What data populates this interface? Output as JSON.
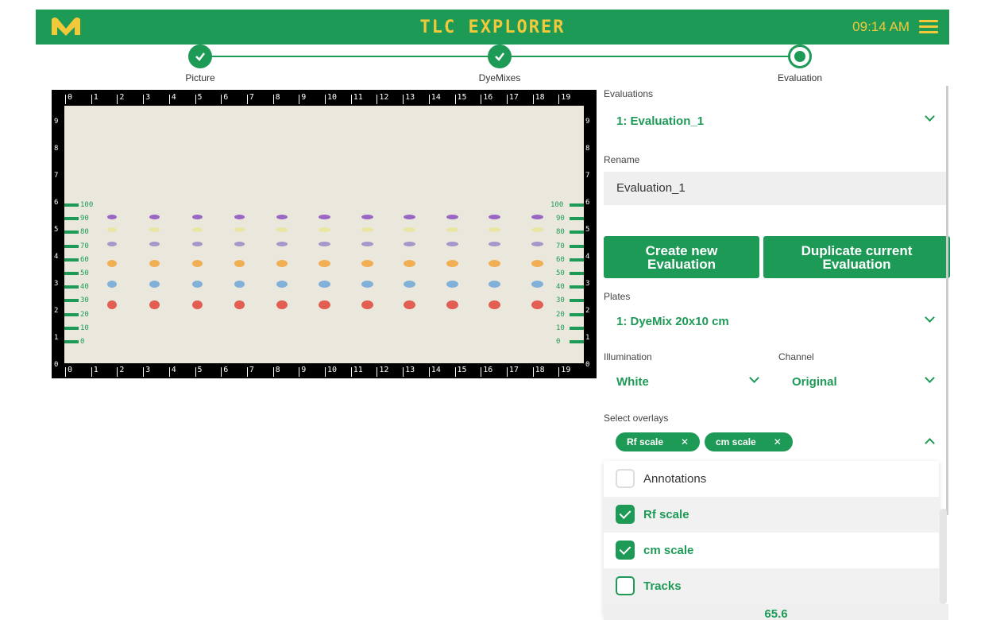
{
  "header": {
    "title": "TLC EXPLORER",
    "time": "09:14 AM",
    "brand_color": "#1e9a57",
    "accent_color": "#f3c93a"
  },
  "stepper": {
    "steps": [
      {
        "label": "Picture",
        "state": "done"
      },
      {
        "label": "DyeMixes",
        "state": "done"
      },
      {
        "label": "Evaluation",
        "state": "active"
      }
    ]
  },
  "plate": {
    "cm_ticks": [
      "0",
      "1",
      "2",
      "3",
      "4",
      "5",
      "6",
      "7",
      "8",
      "9",
      "10",
      "11",
      "12",
      "13",
      "14",
      "15",
      "16",
      "17",
      "18",
      "19"
    ],
    "side_ticks": [
      "9",
      "8",
      "7",
      "6",
      "5",
      "4",
      "3",
      "2",
      "1",
      "0"
    ],
    "rf_ticks": [
      "100",
      "90",
      "80",
      "70",
      "60",
      "50",
      "40",
      "30",
      "20",
      "10",
      "0"
    ],
    "tracks": 11
  },
  "panel": {
    "evaluations": {
      "label": "Evaluations",
      "value": "1: Evaluation_1"
    },
    "rename": {
      "label": "Rename",
      "value": "Evaluation_1"
    },
    "buttons": {
      "create": "Create new Evaluation",
      "duplicate": "Duplicate current Evaluation"
    },
    "plates": {
      "label": "Plates",
      "value": "1: DyeMix 20x10 cm"
    },
    "illumination": {
      "label": "Illumination",
      "value": "White"
    },
    "channel": {
      "label": "Channel",
      "value": "Original"
    },
    "overlays": {
      "label": "Select overlays",
      "chips": [
        "Rf scale",
        "cm scale"
      ],
      "options": [
        {
          "label": "Annotations",
          "checked": false
        },
        {
          "label": "Rf scale",
          "checked": true
        },
        {
          "label": "cm scale",
          "checked": true
        },
        {
          "label": "Tracks",
          "checked": false
        }
      ]
    },
    "bottom_value": "65.6"
  }
}
